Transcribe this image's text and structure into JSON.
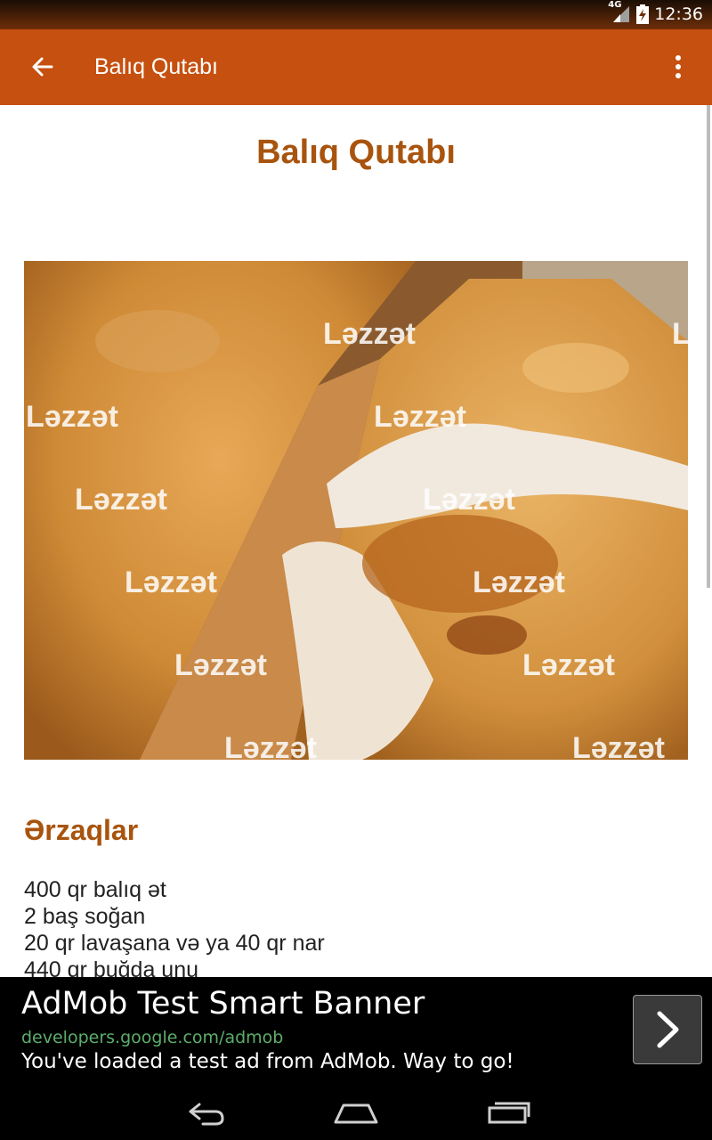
{
  "status_bar": {
    "network": "4G",
    "time": "12:36"
  },
  "app_bar": {
    "title": "Balıq Qutabı",
    "back_icon": "arrow-left-icon",
    "menu_icon": "more-vert-icon"
  },
  "recipe": {
    "title": "Balıq Qutabı",
    "image": {
      "subject": "fried fish qutab",
      "watermark": "Ləzzət"
    },
    "ingredients_heading": "Ərzaqlar",
    "ingredients": [
      "400 qr balıq ət",
      "2 baş soğan",
      "20 qr lavaşana və ya 40 qr nar",
      "440 qr buğda unu"
    ]
  },
  "ad": {
    "title": "AdMob Test Smart Banner",
    "url": "developers.google.com/admob",
    "description": "You've loaded a test ad from AdMob. Way to go!"
  },
  "nav_bar": {
    "back_icon": "nav-back-icon",
    "home_icon": "nav-home-icon",
    "recents_icon": "nav-recents-icon"
  },
  "colors": {
    "app_bar": "#c6500f",
    "accent_text": "#a8540e",
    "ad_url": "#5cae6a"
  }
}
